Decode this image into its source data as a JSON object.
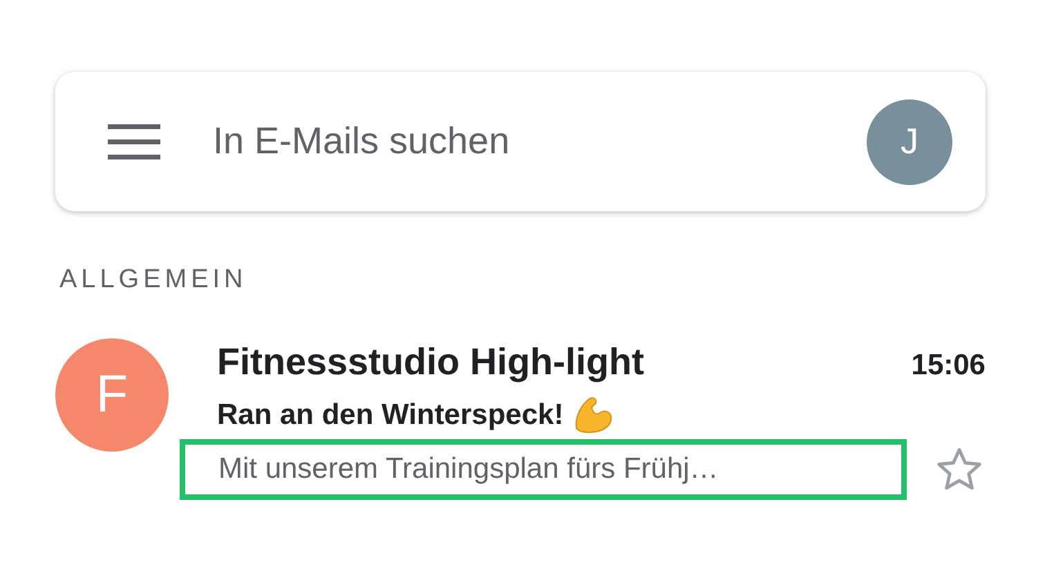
{
  "search": {
    "placeholder": "In E-Mails suchen",
    "account_initial": "J"
  },
  "section_label": "ALLGEMEIN",
  "emails": [
    {
      "avatar_initial": "F",
      "color": "#f5876a",
      "sender": "Fitnessstudio High-light",
      "time": "15:06",
      "subject": "Ran an den Winterspeck!",
      "preview": "Mit unserem Trainingsplan fürs Frühj…",
      "preview_highlighted": true,
      "starred": false
    }
  ]
}
